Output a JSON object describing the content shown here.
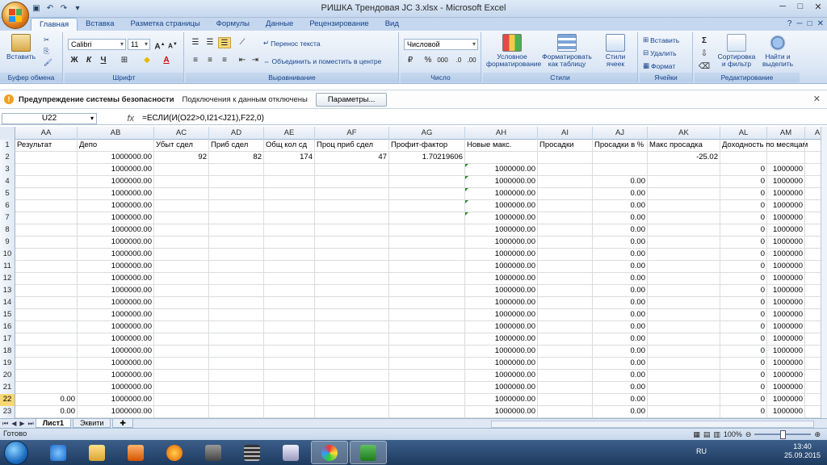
{
  "window": {
    "title": "РИШКА Трендовая JC 3.xlsx - Microsoft Excel"
  },
  "tabs": [
    "Главная",
    "Вставка",
    "Разметка страницы",
    "Формулы",
    "Данные",
    "Рецензирование",
    "Вид"
  ],
  "ribbon": {
    "paste_label": "Вставить",
    "clipboard_label": "Буфер обмена",
    "font_name": "Calibri",
    "font_size": "11",
    "font_label": "Шрифт",
    "wrap_text": "Перенос текста",
    "merge_center": "Объединить и поместить в центре",
    "alignment_label": "Выравнивание",
    "number_format": "Числовой",
    "number_label": "Число",
    "percent": "%",
    "thousands": "000",
    "cond_format": "Условное форматирование",
    "format_table": "Форматировать как таблицу",
    "cell_styles": "Стили ячеек",
    "styles_label": "Стили",
    "insert_btn": "Вставить",
    "delete_btn": "Удалить",
    "format_btn": "Формат",
    "cells_label": "Ячейки",
    "sort_filter": "Сортировка и фильтр",
    "find_select": "Найти и выделить",
    "editing_label": "Редактирование",
    "bold": "Ж",
    "italic": "К",
    "underline": "Ч"
  },
  "security": {
    "title": "Предупреждение системы безопасности",
    "message": "Подключения к данным отключены",
    "button": "Параметры..."
  },
  "formula_bar": {
    "name_box": "U22",
    "fx": "fx",
    "formula": "=ЕСЛИ(И(O22>0,I21<J21),F22,0)"
  },
  "columns": [
    "AA",
    "AB",
    "AC",
    "AD",
    "AE",
    "AF",
    "AG",
    "AH",
    "AI",
    "AJ",
    "AK",
    "AL",
    "AM",
    "AN"
  ],
  "rows": [
    {
      "n": "1",
      "c": [
        "Результат",
        "Депо",
        "Убыт сдел",
        "Приб сдел",
        "Общ кол сд",
        "Проц приб сдел",
        "Профит-фактор",
        "Новые макс.",
        "Просадки",
        "Просадки в %",
        "Макс просадка",
        "Доходность по месяцам",
        "",
        ""
      ]
    },
    {
      "n": "2",
      "c": [
        "",
        "1000000.00",
        "92",
        "82",
        "174",
        "47",
        "1.70219606",
        "",
        "",
        "",
        "-25.02",
        "",
        "",
        ""
      ]
    },
    {
      "n": "3",
      "c": [
        "",
        "1000000.00",
        "",
        "",
        "",
        "",
        "",
        "1000000.00",
        "",
        "",
        "",
        "0",
        "1000000",
        ""
      ]
    },
    {
      "n": "4",
      "c": [
        "",
        "1000000.00",
        "",
        "",
        "",
        "",
        "",
        "1000000.00",
        "",
        "0.00",
        "",
        "0",
        "1000000",
        ""
      ]
    },
    {
      "n": "5",
      "c": [
        "",
        "1000000.00",
        "",
        "",
        "",
        "",
        "",
        "1000000.00",
        "",
        "0.00",
        "",
        "0",
        "1000000",
        ""
      ]
    },
    {
      "n": "6",
      "c": [
        "",
        "1000000.00",
        "",
        "",
        "",
        "",
        "",
        "1000000.00",
        "",
        "0.00",
        "",
        "0",
        "1000000",
        ""
      ]
    },
    {
      "n": "7",
      "c": [
        "",
        "1000000.00",
        "",
        "",
        "",
        "",
        "",
        "1000000.00",
        "",
        "0.00",
        "",
        "0",
        "1000000",
        ""
      ]
    },
    {
      "n": "8",
      "c": [
        "",
        "1000000.00",
        "",
        "",
        "",
        "",
        "",
        "1000000.00",
        "",
        "0.00",
        "",
        "0",
        "1000000",
        ""
      ]
    },
    {
      "n": "9",
      "c": [
        "",
        "1000000.00",
        "",
        "",
        "",
        "",
        "",
        "1000000.00",
        "",
        "0.00",
        "",
        "0",
        "1000000",
        ""
      ]
    },
    {
      "n": "10",
      "c": [
        "",
        "1000000.00",
        "",
        "",
        "",
        "",
        "",
        "1000000.00",
        "",
        "0.00",
        "",
        "0",
        "1000000",
        ""
      ]
    },
    {
      "n": "11",
      "c": [
        "",
        "1000000.00",
        "",
        "",
        "",
        "",
        "",
        "1000000.00",
        "",
        "0.00",
        "",
        "0",
        "1000000",
        ""
      ]
    },
    {
      "n": "12",
      "c": [
        "",
        "1000000.00",
        "",
        "",
        "",
        "",
        "",
        "1000000.00",
        "",
        "0.00",
        "",
        "0",
        "1000000",
        ""
      ]
    },
    {
      "n": "13",
      "c": [
        "",
        "1000000.00",
        "",
        "",
        "",
        "",
        "",
        "1000000.00",
        "",
        "0.00",
        "",
        "0",
        "1000000",
        ""
      ]
    },
    {
      "n": "14",
      "c": [
        "",
        "1000000.00",
        "",
        "",
        "",
        "",
        "",
        "1000000.00",
        "",
        "0.00",
        "",
        "0",
        "1000000",
        ""
      ]
    },
    {
      "n": "15",
      "c": [
        "",
        "1000000.00",
        "",
        "",
        "",
        "",
        "",
        "1000000.00",
        "",
        "0.00",
        "",
        "0",
        "1000000",
        ""
      ]
    },
    {
      "n": "16",
      "c": [
        "",
        "1000000.00",
        "",
        "",
        "",
        "",
        "",
        "1000000.00",
        "",
        "0.00",
        "",
        "0",
        "1000000",
        ""
      ]
    },
    {
      "n": "17",
      "c": [
        "",
        "1000000.00",
        "",
        "",
        "",
        "",
        "",
        "1000000.00",
        "",
        "0.00",
        "",
        "0",
        "1000000",
        ""
      ]
    },
    {
      "n": "18",
      "c": [
        "",
        "1000000.00",
        "",
        "",
        "",
        "",
        "",
        "1000000.00",
        "",
        "0.00",
        "",
        "0",
        "1000000",
        ""
      ]
    },
    {
      "n": "19",
      "c": [
        "",
        "1000000.00",
        "",
        "",
        "",
        "",
        "",
        "1000000.00",
        "",
        "0.00",
        "",
        "0",
        "1000000",
        ""
      ]
    },
    {
      "n": "20",
      "c": [
        "",
        "1000000.00",
        "",
        "",
        "",
        "",
        "",
        "1000000.00",
        "",
        "0.00",
        "",
        "0",
        "1000000",
        ""
      ]
    },
    {
      "n": "21",
      "c": [
        "",
        "1000000.00",
        "",
        "",
        "",
        "",
        "",
        "1000000.00",
        "",
        "0.00",
        "",
        "0",
        "1000000",
        ""
      ]
    },
    {
      "n": "22",
      "c": [
        "0.00",
        "1000000.00",
        "",
        "",
        "",
        "",
        "",
        "1000000.00",
        "",
        "0.00",
        "",
        "0",
        "1000000",
        ""
      ]
    },
    {
      "n": "23",
      "c": [
        "0.00",
        "1000000.00",
        "",
        "",
        "",
        "",
        "",
        "1000000.00",
        "",
        "0.00",
        "",
        "0",
        "1000000",
        ""
      ]
    }
  ],
  "sheets": [
    "Лист1",
    "Эквити"
  ],
  "status": {
    "ready": "Готово",
    "zoom": "100%"
  },
  "tray": {
    "lang": "RU",
    "time": "13:40",
    "date": "25.09.2015"
  }
}
